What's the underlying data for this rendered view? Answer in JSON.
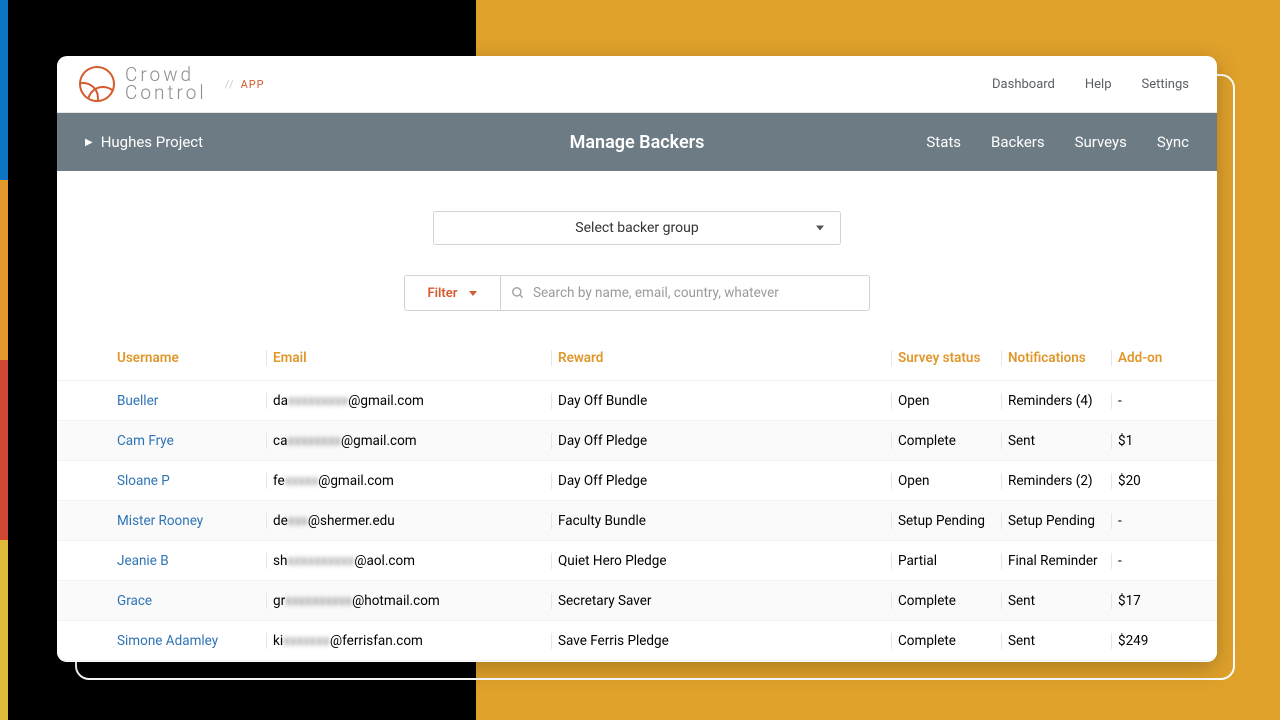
{
  "brand": {
    "line1": "Crowd",
    "line2": "Control",
    "sep": "//",
    "sub": "APP"
  },
  "topnav": {
    "dashboard": "Dashboard",
    "help": "Help",
    "settings": "Settings"
  },
  "subbar": {
    "project": "Hughes Project",
    "title": "Manage Backers",
    "nav": {
      "stats": "Stats",
      "backers": "Backers",
      "surveys": "Surveys",
      "sync": "Sync"
    }
  },
  "controls": {
    "group_select": "Select backer group",
    "filter_label": "Filter",
    "search_placeholder": "Search by name, email, country, whatever"
  },
  "table": {
    "headers": {
      "username": "Username",
      "email": "Email",
      "reward": "Reward",
      "survey": "Survey status",
      "notif": "Notifications",
      "addon": "Add-on"
    },
    "rows": [
      {
        "username": "Bueller",
        "email_pre": "da",
        "email_mid": "xxxxxxxxx",
        "email_suf": "@gmail.com",
        "reward": "Day Off Bundle",
        "survey": "Open",
        "notif": "Reminders (4)",
        "addon": "-"
      },
      {
        "username": "Cam Frye",
        "email_pre": "ca",
        "email_mid": "xxxxxxxx",
        "email_suf": "@gmail.com",
        "reward": "Day Off Pledge",
        "survey": "Complete",
        "notif": "Sent",
        "addon": "$1"
      },
      {
        "username": "Sloane P",
        "email_pre": "fe",
        "email_mid": "xxxxx",
        "email_suf": "@gmail.com",
        "reward": "Day Off Pledge",
        "survey": "Open",
        "notif": "Reminders (2)",
        "addon": "$20"
      },
      {
        "username": "Mister Rooney",
        "email_pre": "de",
        "email_mid": "xxx",
        "email_suf": "@shermer.edu",
        "reward": "Faculty Bundle",
        "survey": "Setup Pending",
        "notif": "Setup Pending",
        "addon": "-"
      },
      {
        "username": "Jeanie B",
        "email_pre": "sh",
        "email_mid": "xxxxxxxxxx",
        "email_suf": "@aol.com",
        "reward": "Quiet Hero Pledge",
        "survey": "Partial",
        "notif": "Final Reminder",
        "addon": "-"
      },
      {
        "username": "Grace",
        "email_pre": "gr",
        "email_mid": "xxxxxxxxxx",
        "email_suf": "@hotmail.com",
        "reward": "Secretary Saver",
        "survey": "Complete",
        "notif": "Sent",
        "addon": "$17"
      },
      {
        "username": "Simone Adamley",
        "email_pre": "ki",
        "email_mid": "xxxxxxx",
        "email_suf": "@ferrisfan.com",
        "reward": "Save Ferris Pledge",
        "survey": "Complete",
        "notif": "Sent",
        "addon": "$249"
      }
    ]
  }
}
